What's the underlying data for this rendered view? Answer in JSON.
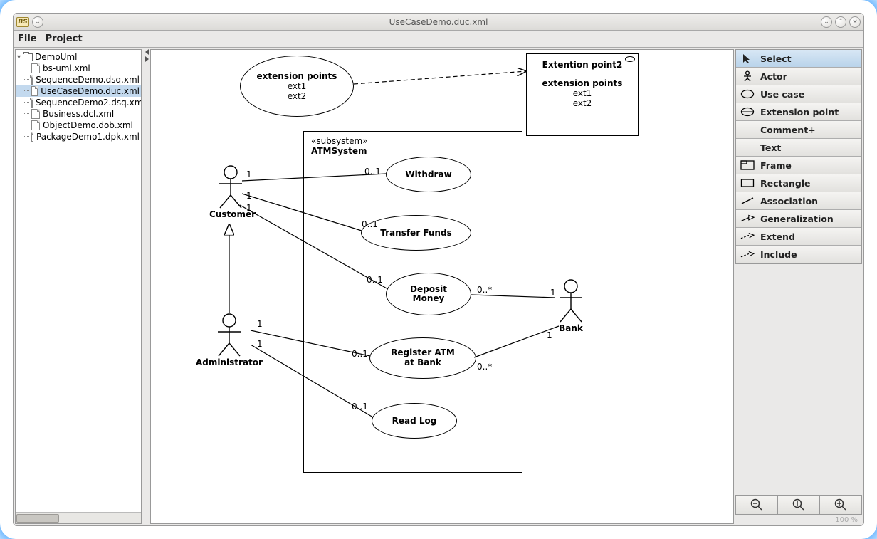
{
  "window": {
    "badge": "BS",
    "title": "UseCaseDemo.duc.xml"
  },
  "menu": {
    "file": "File",
    "project": "Project"
  },
  "tree": {
    "root": "DemoUml",
    "items": [
      "bs-uml.xml",
      "SequenceDemo.dsq.xml",
      "UseCaseDemo.duc.xml",
      "SequenceDemo2.dsq.xml",
      "Business.dcl.xml",
      "ObjectDemo.dob.xml",
      "PackageDemo1.dpk.xml"
    ],
    "selected_index": 2
  },
  "tools": {
    "items": [
      {
        "label": "Select"
      },
      {
        "label": "Actor"
      },
      {
        "label": "Use case"
      },
      {
        "label": "Extension point"
      },
      {
        "label": "Comment+"
      },
      {
        "label": "Text"
      },
      {
        "label": "Frame"
      },
      {
        "label": "Rectangle"
      },
      {
        "label": "Association"
      },
      {
        "label": "Generalization"
      },
      {
        "label": "Extend"
      },
      {
        "label": "Include"
      }
    ],
    "selected_index": 0
  },
  "zoom": {
    "pct": "100 %"
  },
  "diagram": {
    "ext_ellipse": {
      "header": "extension points",
      "lines": [
        "ext1",
        "ext2"
      ]
    },
    "ext_rect": {
      "title": "Extention point2",
      "header": "extension points",
      "lines": [
        "ext1",
        "ext2"
      ]
    },
    "subsystem": {
      "stereo": "«subsystem»",
      "name": "ATMSystem"
    },
    "usecases": {
      "withdraw": "Withdraw",
      "transfer": "Transfer Funds",
      "deposit": "Deposit Money",
      "register": "Register ATM at Bank",
      "readlog": "Read Log"
    },
    "actors": {
      "customer": "Customer",
      "administrator": "Administrator",
      "bank": "Bank"
    },
    "mult": {
      "one": "1",
      "zero_one": "0..1",
      "zero_many": "0..*"
    }
  }
}
